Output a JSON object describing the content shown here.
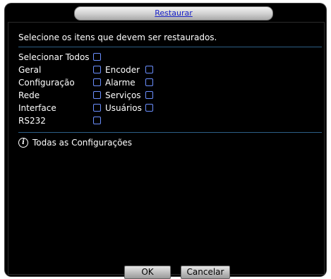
{
  "dialog": {
    "title": "Restaurar"
  },
  "header": {
    "text": "Selecione os itens que devem ser restaurados."
  },
  "options": {
    "select_all": {
      "label": "Selecionar Todos",
      "checked": false
    },
    "geral": {
      "label": "Geral",
      "checked": false
    },
    "encoder": {
      "label": "Encoder",
      "checked": false
    },
    "configuracao": {
      "label": "Configuração",
      "checked": false
    },
    "alarme": {
      "label": "Alarme",
      "checked": false
    },
    "rede": {
      "label": "Rede",
      "checked": false
    },
    "servicos": {
      "label": "Serviços",
      "checked": false
    },
    "interface": {
      "label": "Interface",
      "checked": false
    },
    "usuarios": {
      "label": "Usuários",
      "checked": false
    },
    "rs232": {
      "label": "RS232",
      "checked": false
    }
  },
  "info": {
    "text": "Todas as Configurações",
    "icon": "info-icon"
  },
  "buttons": {
    "ok": "OK",
    "cancel": "Cancelar"
  },
  "colors": {
    "title_text": "#1a23c8",
    "separator": "#2c5e86",
    "checkbox_border": "#6b8fff"
  }
}
